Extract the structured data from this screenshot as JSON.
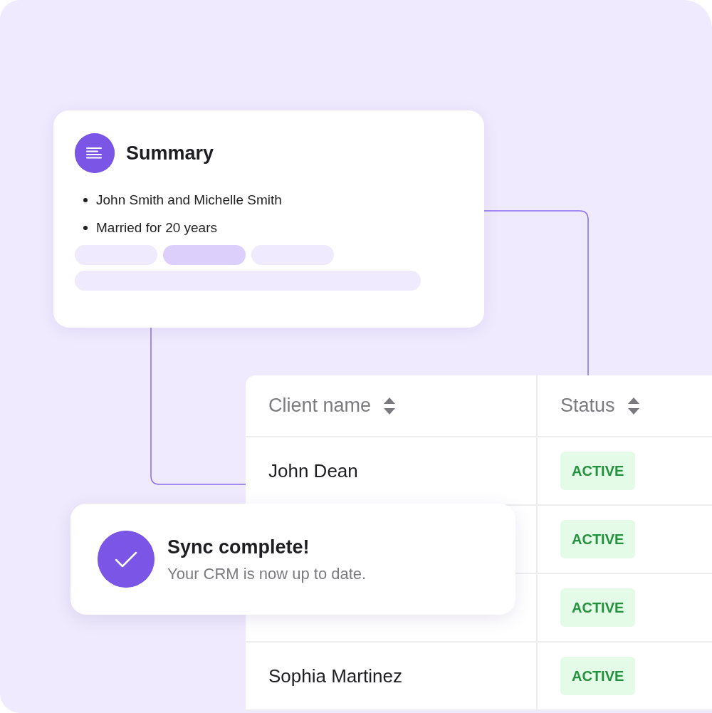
{
  "summary_card": {
    "title": "Summary",
    "bullets": [
      "John Smith and Michelle Smith",
      "Married for 20 years"
    ]
  },
  "table": {
    "columns": [
      "Client name",
      "Status"
    ],
    "rows": [
      {
        "client_name": "John Dean",
        "status": "ACTIVE"
      },
      {
        "status": "ACTIVE"
      },
      {
        "status": "ACTIVE"
      },
      {
        "client_name": "Sophia Martinez",
        "status": "ACTIVE"
      }
    ]
  },
  "toast": {
    "title": "Sync complete!",
    "message": "Your CRM is now up to date."
  }
}
